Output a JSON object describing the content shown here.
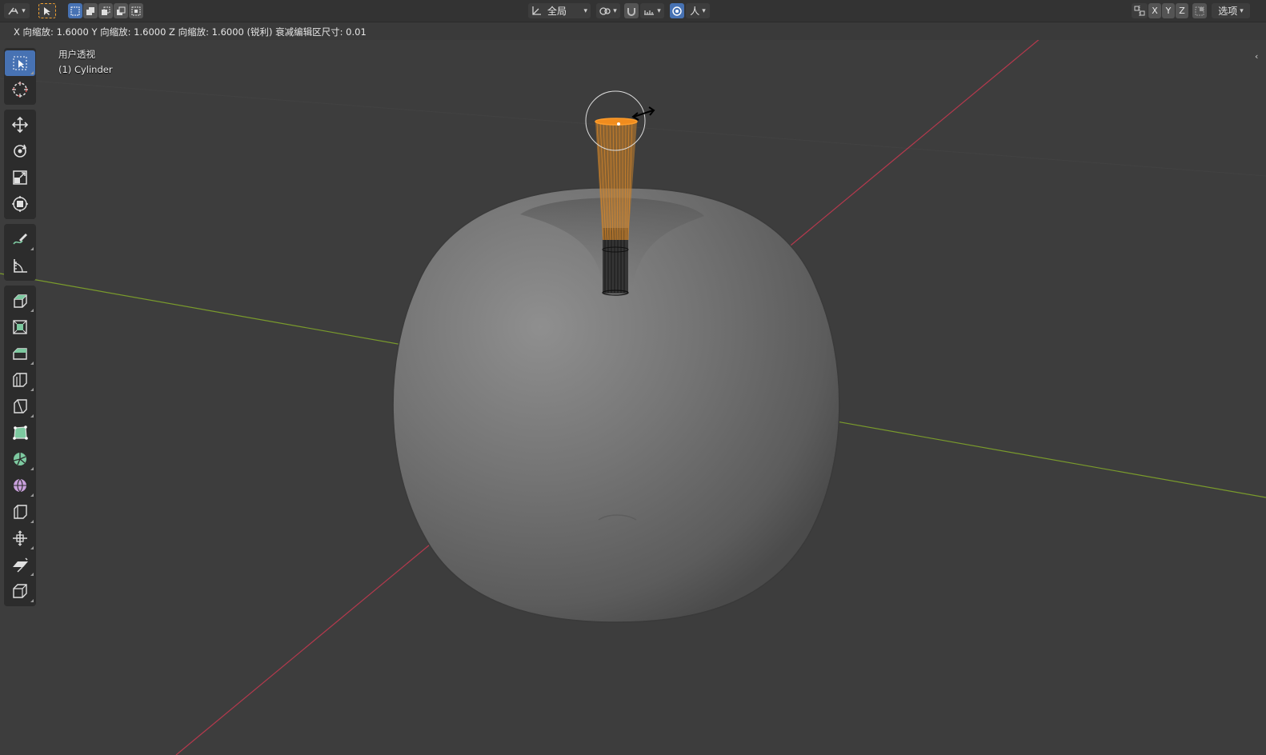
{
  "header": {
    "orientation_label": "全局",
    "axis_buttons": [
      "X",
      "Y",
      "Z"
    ],
    "options_label": "选项",
    "proportional_falloff_label": "人"
  },
  "status": {
    "operator_text": "X 向缩放: 1.6000   Y 向缩放: 1.6000   Z 向缩放: 1.6000 (锐利) 衰减编辑区尺寸: 0.01"
  },
  "viewport": {
    "view_name": "用户透视",
    "active_object": "(1) Cylinder"
  },
  "toolbar": {
    "tools": [
      {
        "name": "select-box-tool",
        "icon": "select-box-icon",
        "active": true
      },
      {
        "name": "cursor-tool",
        "icon": "cursor-icon"
      },
      {
        "name": "move-tool",
        "icon": "move-icon"
      },
      {
        "name": "rotate-tool",
        "icon": "rotate-icon"
      },
      {
        "name": "scale-tool",
        "icon": "scale-icon"
      },
      {
        "name": "transform-tool",
        "icon": "transform-icon"
      },
      {
        "name": "annotate-tool",
        "icon": "annotate-icon"
      },
      {
        "name": "measure-tool",
        "icon": "measure-icon"
      },
      {
        "name": "extrude-region-tool",
        "icon": "extrude-icon"
      },
      {
        "name": "inset-faces-tool",
        "icon": "inset-icon"
      },
      {
        "name": "bevel-tool",
        "icon": "bevel-icon"
      },
      {
        "name": "loop-cut-tool",
        "icon": "loop-cut-icon"
      },
      {
        "name": "knife-tool",
        "icon": "knife-icon"
      },
      {
        "name": "poly-build-tool",
        "icon": "poly-build-icon"
      },
      {
        "name": "spin-tool",
        "icon": "spin-icon"
      },
      {
        "name": "smooth-tool",
        "icon": "smooth-icon"
      },
      {
        "name": "edge-slide-tool",
        "icon": "edge-slide-icon"
      },
      {
        "name": "shrink-fatten-tool",
        "icon": "shrink-fatten-icon"
      },
      {
        "name": "shear-tool",
        "icon": "shear-icon"
      },
      {
        "name": "rip-region-tool",
        "icon": "rip-icon"
      }
    ]
  },
  "colors": {
    "background": "#3d3d3d",
    "x_axis": "#b5394d",
    "y_axis": "#7a9b2c",
    "selection": "#f08c1e",
    "accent": "#4772b3"
  }
}
